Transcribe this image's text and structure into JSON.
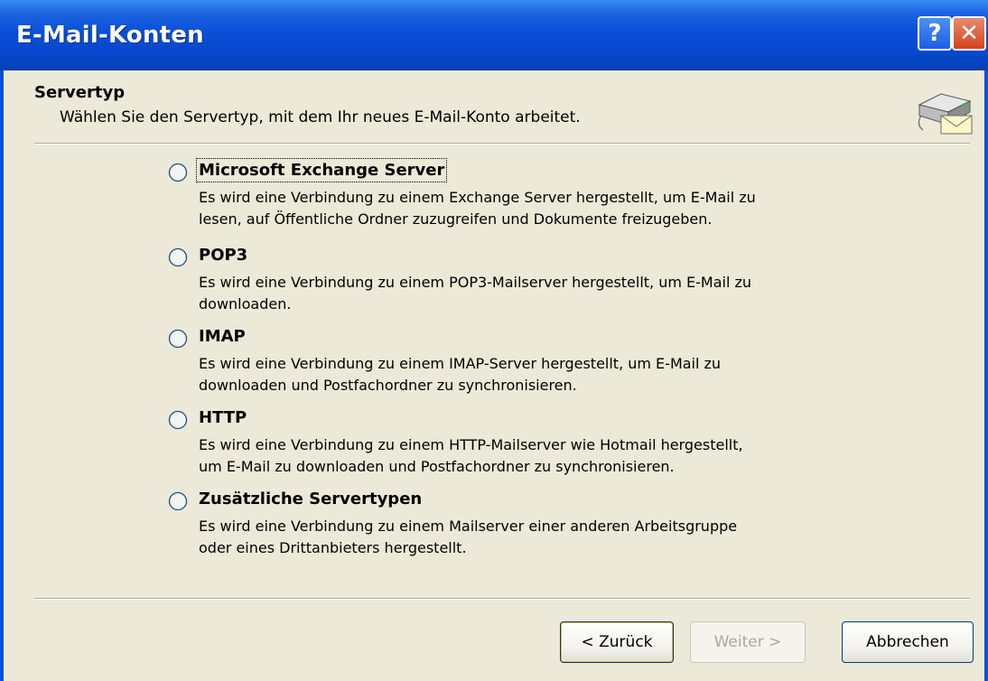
{
  "window": {
    "title": "E-Mail-Konten",
    "help_label": "?",
    "close_label": "✕"
  },
  "header": {
    "title": "Servertyp",
    "subtitle": "Wählen Sie den Servertyp, mit dem Ihr neues E-Mail-Konto arbeitet.",
    "icon": "server-mail-icon"
  },
  "options": [
    {
      "label": "Microsoft Exchange Server",
      "description_lines": [
        "Es wird eine Verbindung zu einem Exchange Server hergestellt, um E-Mail zu",
        "lesen, auf Öffentliche Ordner zuzugreifen und Dokumente freizugeben."
      ],
      "selected": false,
      "focused": true
    },
    {
      "label": "POP3",
      "description_lines": [
        "Es wird eine Verbindung zu einem POP3-Mailserver hergestellt, um E-Mail zu",
        "downloaden."
      ],
      "selected": false
    },
    {
      "label": "IMAP",
      "description_lines": [
        "Es wird eine Verbindung zu einem IMAP-Server hergestellt, um E-Mail zu",
        "downloaden und Postfachordner zu synchronisieren."
      ],
      "selected": false
    },
    {
      "label": "HTTP",
      "description_lines": [
        "Es wird eine Verbindung zu einem HTTP-Mailserver wie Hotmail hergestellt,",
        "um E-Mail zu downloaden und Postfachordner zu synchronisieren."
      ],
      "selected": false
    },
    {
      "label": "Zusätzliche Servertypen",
      "description_lines": [
        "Es wird eine Verbindung zu einem Mailserver einer anderen Arbeitsgruppe",
        "oder eines Drittanbieters hergestellt."
      ],
      "selected": false
    }
  ],
  "buttons": {
    "back": "< Zurück",
    "next": "Weiter >",
    "cancel": "Abbrechen"
  },
  "colors": {
    "titlebar": "#0A4FD8",
    "dialog_background": "#ECE9D8",
    "disabled_text": "#ACA899"
  }
}
